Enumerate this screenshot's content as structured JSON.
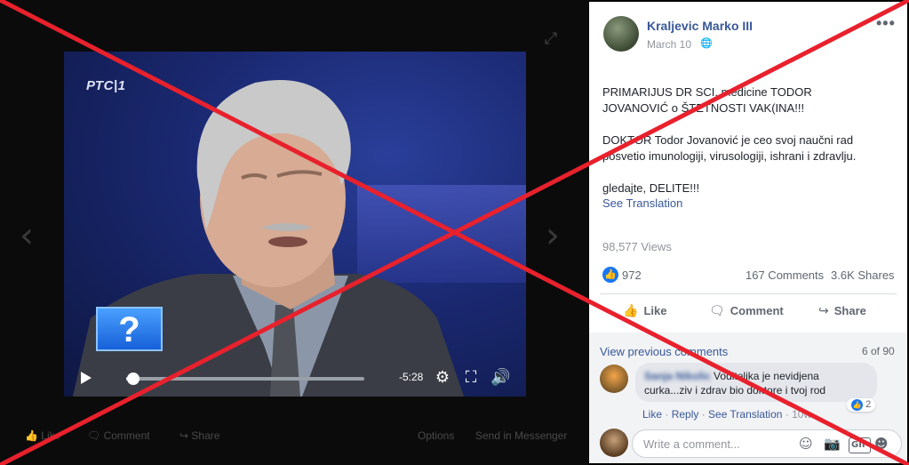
{
  "media": {
    "tv_logo": "РТС|1",
    "question_mark": "?",
    "time_remaining": "-5:28",
    "progress": 0.03,
    "actions": {
      "like": "Like",
      "comment": "Comment",
      "share": "Share",
      "options": "Options",
      "send": "Send in Messenger"
    },
    "icons": [
      "expand-icon",
      "chevron-left-icon",
      "chevron-right-icon",
      "play-icon",
      "settings-icon",
      "fullscreen-icon",
      "volume-icon"
    ]
  },
  "post": {
    "author": "Kraljevic Marko III",
    "date": "March 10",
    "lines": [
      "PRIMARIJUS DR SCI. medicine TODOR",
      "JOVANOVIĆ o ŠTETNOSTI VAK(INA!!!",
      "DOKTOR Todor Jovanović je ceo svoj naučni rad",
      "posvetio imunologiji, virusologiji, ishrani i zdravlju.",
      "gledajte, DELITE!!!"
    ],
    "see_translation": "See Translation",
    "views": "98,577 Views",
    "reactions": "972",
    "comments_count": "167 Comments",
    "shares_count": "3.6K Shares",
    "actions": {
      "like": "Like",
      "comment": "Comment",
      "share": "Share"
    }
  },
  "comments": {
    "view_previous": "View previous comments",
    "pager": "6 of 90",
    "items": [
      {
        "name": "Sanja Nikolic",
        "text_line1": "Voditeljka je nevidjena",
        "text_line2": "curka...ziv i zdrav bio doktore i tvoj rod",
        "reactions": "2",
        "like": "Like",
        "reply": "Reply",
        "see_translation": "See Translation",
        "time": "10w"
      }
    ],
    "write_placeholder": "Write a comment..."
  },
  "overlay": {
    "x_color": "#e8212d"
  }
}
